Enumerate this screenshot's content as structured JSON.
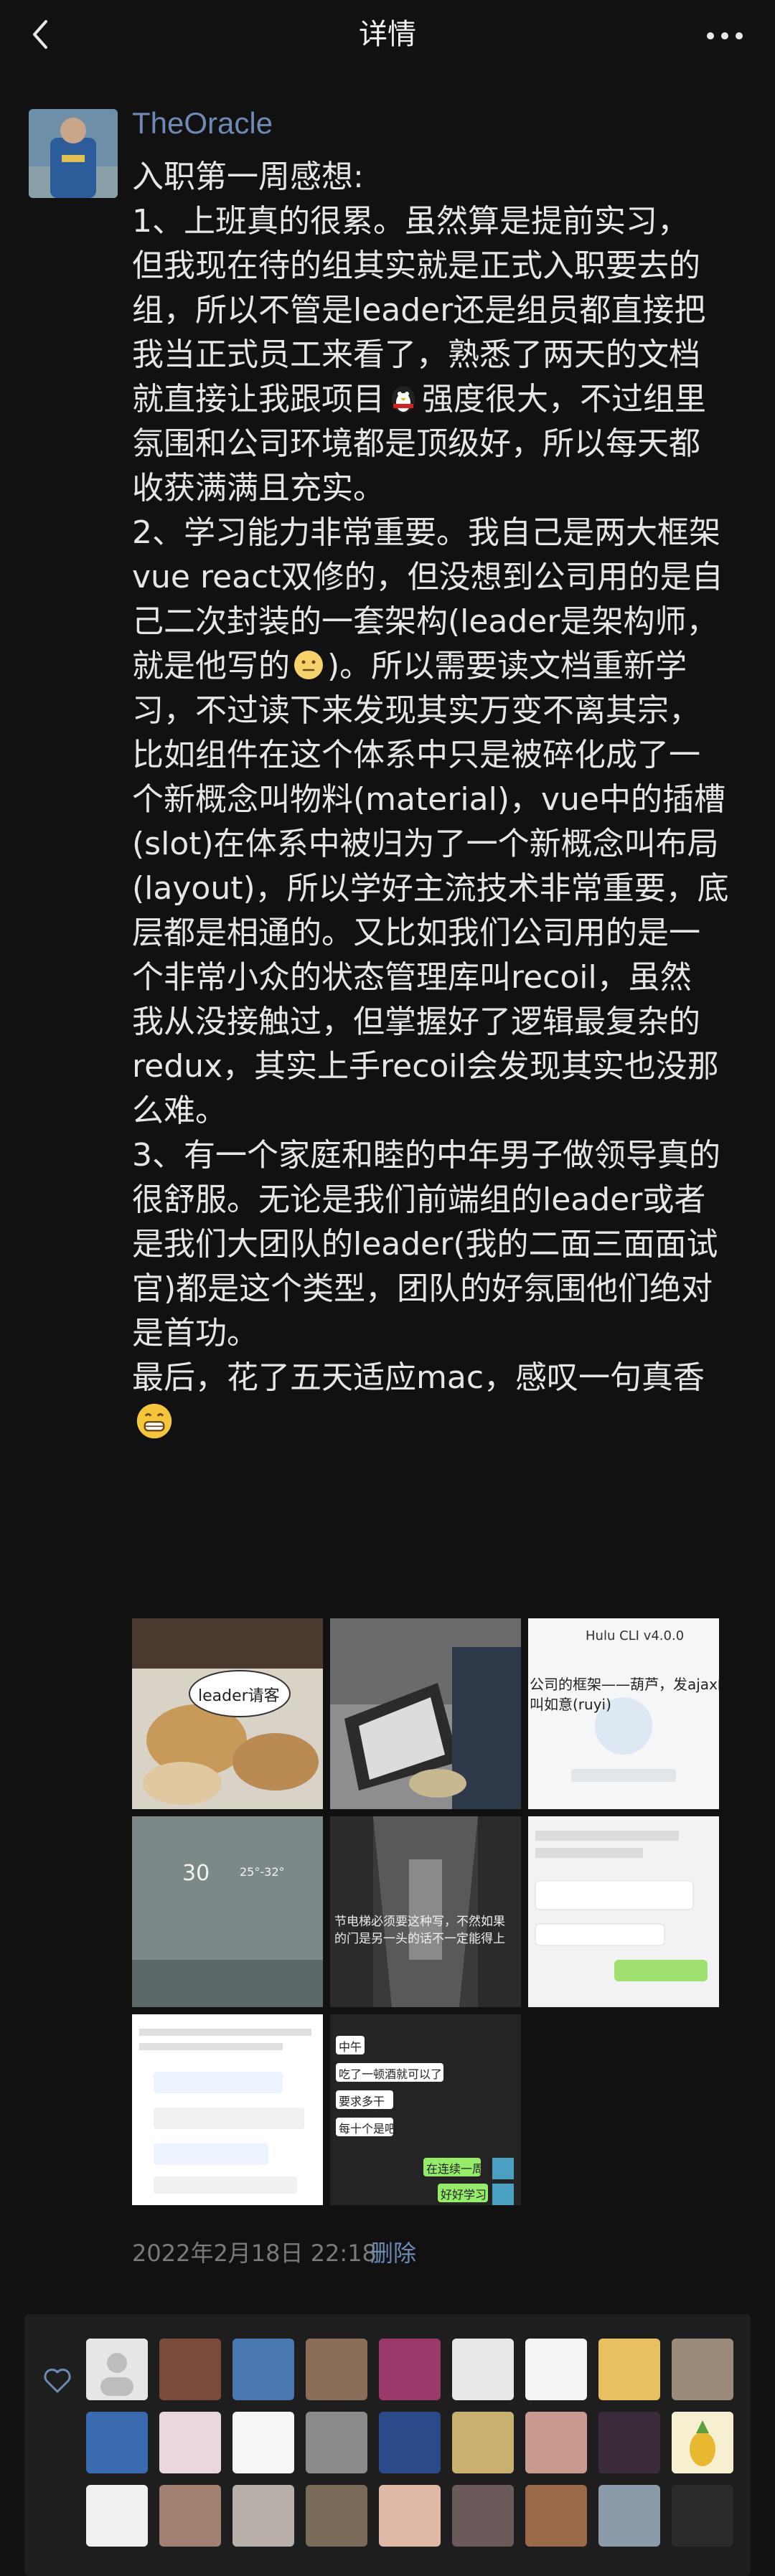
{
  "header": {
    "title": "详情"
  },
  "post": {
    "author": "TheOracle",
    "content": [
      "入职第一周感想:",
      "1、上班真的很累。虽然算是提前实习，",
      "但我现在待的组其实就是正式入职要去的",
      "组，所以不管是leader还是组员都直接把",
      "我当正式员工来看了，熟悉了两天的文档",
      "就直接让我跟项目",
      "强度很大，不过组里",
      "氛围和公司环境都是顶级好，所以每天都",
      "收获满满且充实。",
      "2、学习能力非常重要。我自己是两大框架",
      "vue react双修的，但没想到公司用的是自",
      "己二次封装的一套架构(leader是架构师，",
      "就是他写的",
      ")。所以需要读文档重新学",
      "习，不过读下来发现其实万变不离其宗，",
      "比如组件在这个体系中只是被碎化成了一",
      "个新概念叫物料(material)，vue中的插槽",
      "(slot)在体系中被归为了一个新概念叫布局",
      "(layout)，所以学好主流技术非常重要，底",
      "层都是相通的。又比如我们公司用的是一",
      "个非常小众的状态管理库叫recoil，虽然",
      "我从没接触过，但掌握好了逻辑最复杂的",
      "redux，其实上手recoil会发现其实也没那",
      "么难。",
      "3、有一个家庭和睦的中年男子做领导真的",
      "很舒服。无论是我们前端组的leader或者",
      "是我们大团队的leader(我的二面三面面试",
      "官)都是这个类型，团队的好氛围他们绝对",
      "是首功。",
      "最后，花了五天适应mac，感叹一句真香"
    ],
    "time": "2022年2月18日 22:18",
    "delete_label": "删除"
  },
  "images": [
    {
      "caption": "leader请客"
    },
    {
      "caption": ""
    },
    {
      "caption": "Hulu CLI v4.0.0",
      "caption2": "公司的框架——葫芦，发ajax的方",
      "caption3": "叫如意(ruyi)"
    },
    {
      "caption": "30",
      "caption2": "25°-32°"
    },
    {
      "caption": "节电梯必须要这种写，不然如果",
      "caption2": "的门是另一头的话不一定能得上"
    },
    {
      "caption": ""
    },
    {
      "caption": ""
    },
    {
      "caption": "中午",
      "caption2": "吃了一顿酒就可以了",
      "caption3": "要求多干",
      "caption4": "每十个是吧",
      "caption5": "在连续一周",
      "caption6": "好好学习"
    }
  ],
  "icons": {
    "back": "chevron-left-icon",
    "more": "more-dots-icon",
    "heart": "heart-outline-icon"
  },
  "colors": {
    "background": "#111111",
    "link": "#6d8ab3",
    "text": "#e6e6e6",
    "likes_bg": "#1e1e1e"
  }
}
